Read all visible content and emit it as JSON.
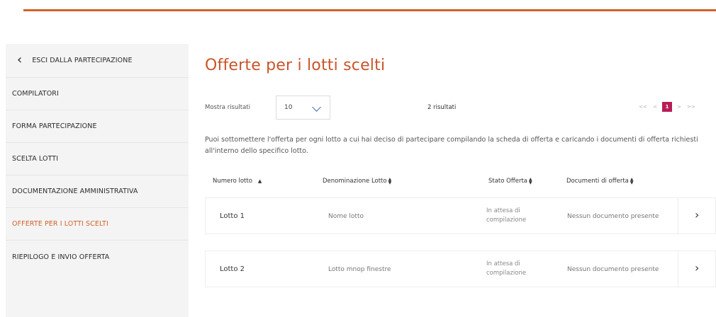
{
  "sidebar": {
    "exit_label": "ESCI DALLA PARTECIPAZIONE",
    "items": [
      {
        "label": "COMPILATORI"
      },
      {
        "label": "FORMA PARTECIPAZIONE"
      },
      {
        "label": "SCELTA LOTTI"
      },
      {
        "label": "DOCUMENTAZIONE AMMINISTRATIVA"
      },
      {
        "label": "OFFERTE PER I LOTTI SCELTI"
      },
      {
        "label": "RIEPILOGO E INVIO OFFERTA"
      }
    ]
  },
  "main": {
    "title": "Offerte per i lotti scelti",
    "show_label": "Mostra risultati",
    "show_value": "10",
    "results_count": "2 risultati",
    "pager": {
      "first": "<<",
      "prev": "<",
      "current": "1",
      "next": ">",
      "last": ">>"
    },
    "description": "Puoi sottomettere l'offerta per ogni lotto a cui hai deciso di partecipare compilando la scheda di offerta e caricando i documenti di offerta richiesti all'interno dello specifico lotto.",
    "columns": {
      "numero": "Numero lotto",
      "denominazione": "Denominazione Lotto",
      "stato": "Stato Offerta",
      "documenti": "Documenti di offerta"
    },
    "rows": [
      {
        "lotto": "Lotto 1",
        "nome": "Nome lotto",
        "stato": "In attesa di compilazione",
        "documenti": "Nessun documento presente"
      },
      {
        "lotto": "Lotto 2",
        "nome": "Lotto mnop finestre",
        "stato": "In attesa di compilazione",
        "documenti": "Nessun documento presente"
      }
    ]
  },
  "colors": {
    "accent": "#d4612b",
    "title": "#c9542a",
    "pager_active": "#b81d57"
  }
}
